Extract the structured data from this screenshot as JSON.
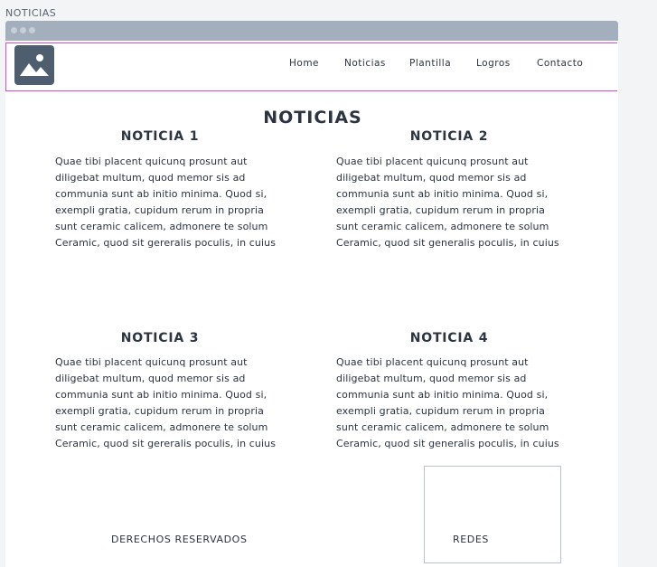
{
  "page_label": "NOTICIAS",
  "nav": {
    "items": [
      "Home",
      "Noticias",
      "Plantilla",
      "Logros",
      "Contacto"
    ]
  },
  "main": {
    "title": "NOTICIAS",
    "news": [
      {
        "title": "NOTICIA 1",
        "lines": [
          "Quae tibi placent quicunq prosunt aut",
          "diligebat multum, quod memor sis ad",
          "communia sunt ab initio minima. Quod si,",
          "exempli gratia, cupidum rerum in propria",
          "sunt ceramic calicem, admonere te solum",
          "Ceramic, quod sit gereralis poculis, in cuius"
        ]
      },
      {
        "title": "NOTICIA 2",
        "lines": [
          "Quae tibi placent quicunq prosunt aut",
          "diligebat multum, quod memor sis ad",
          "communia sunt ab initio minima. Quod si,",
          "exempli gratia, cupidum rerum in propria",
          "sunt ceramic calicem, admonere te solum",
          "Ceramic, quod sit generalis poculis, in cuius"
        ]
      },
      {
        "title": "NOTICIA 3",
        "lines": [
          "Quae tibi placent quicunq prosunt aut",
          "diligebat multum, quod memor sis ad",
          "communia sunt ab initio minima. Quod si,",
          "exempli gratia, cupidum rerum in propria",
          "sunt ceramic calicem, admonere te solum",
          "Ceramic, quod sit gereralis poculis, in cuius"
        ]
      },
      {
        "title": "NOTICIA 4",
        "lines": [
          "Quae tibi placent quicunq prosunt aut",
          "diligebat multum, quod memor sis ad",
          "communia sunt ab initio minima. Quod si,",
          "exempli gratia, cupidum rerum in propria",
          "sunt ceramic calicem, admonere te solum",
          "Ceramic, quod sit generalis poculis, in cuius"
        ]
      }
    ]
  },
  "footer": {
    "rights": "DERECHOS RESERVADOS",
    "social": "REDES"
  },
  "icons": {
    "logo": "image-placeholder-icon",
    "window_controls": "window-dots-icon"
  },
  "colors": {
    "titlebar": "#a3afbd",
    "header_border": "#d24ad8",
    "logo_bg": "#4f5e6e",
    "text": "#2b3440"
  }
}
